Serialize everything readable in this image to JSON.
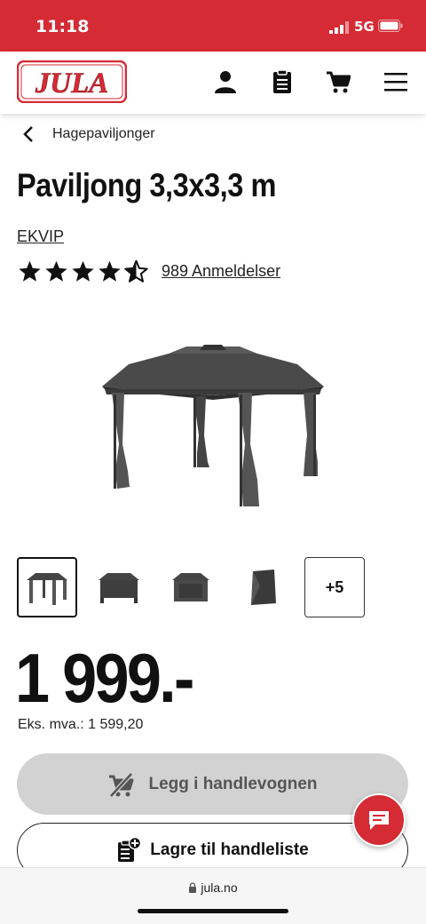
{
  "status_bar": {
    "time": "11:18",
    "network": "5G"
  },
  "header": {
    "logo_text": "JULA",
    "icons": [
      "user-icon",
      "shopping-list-icon",
      "cart-icon",
      "menu-icon"
    ]
  },
  "breadcrumb": {
    "label": "Hagepaviljonger"
  },
  "product": {
    "title": "Paviljong 3,3x3,3 m",
    "brand": "EKVIP",
    "rating": 4.5,
    "reviews_label": "989 Anmeldelser",
    "thumbnails_more": "+5",
    "price": "1 999.-",
    "price_ex_vat": "Eks. mva.: 1 599,20"
  },
  "actions": {
    "add_to_cart": "Legg i handlevognen",
    "save_to_list": "Lagre til handleliste"
  },
  "browser": {
    "url": "jula.no"
  },
  "colors": {
    "brand_red": "#d52b35",
    "disabled_button": "#d2d2d2"
  }
}
